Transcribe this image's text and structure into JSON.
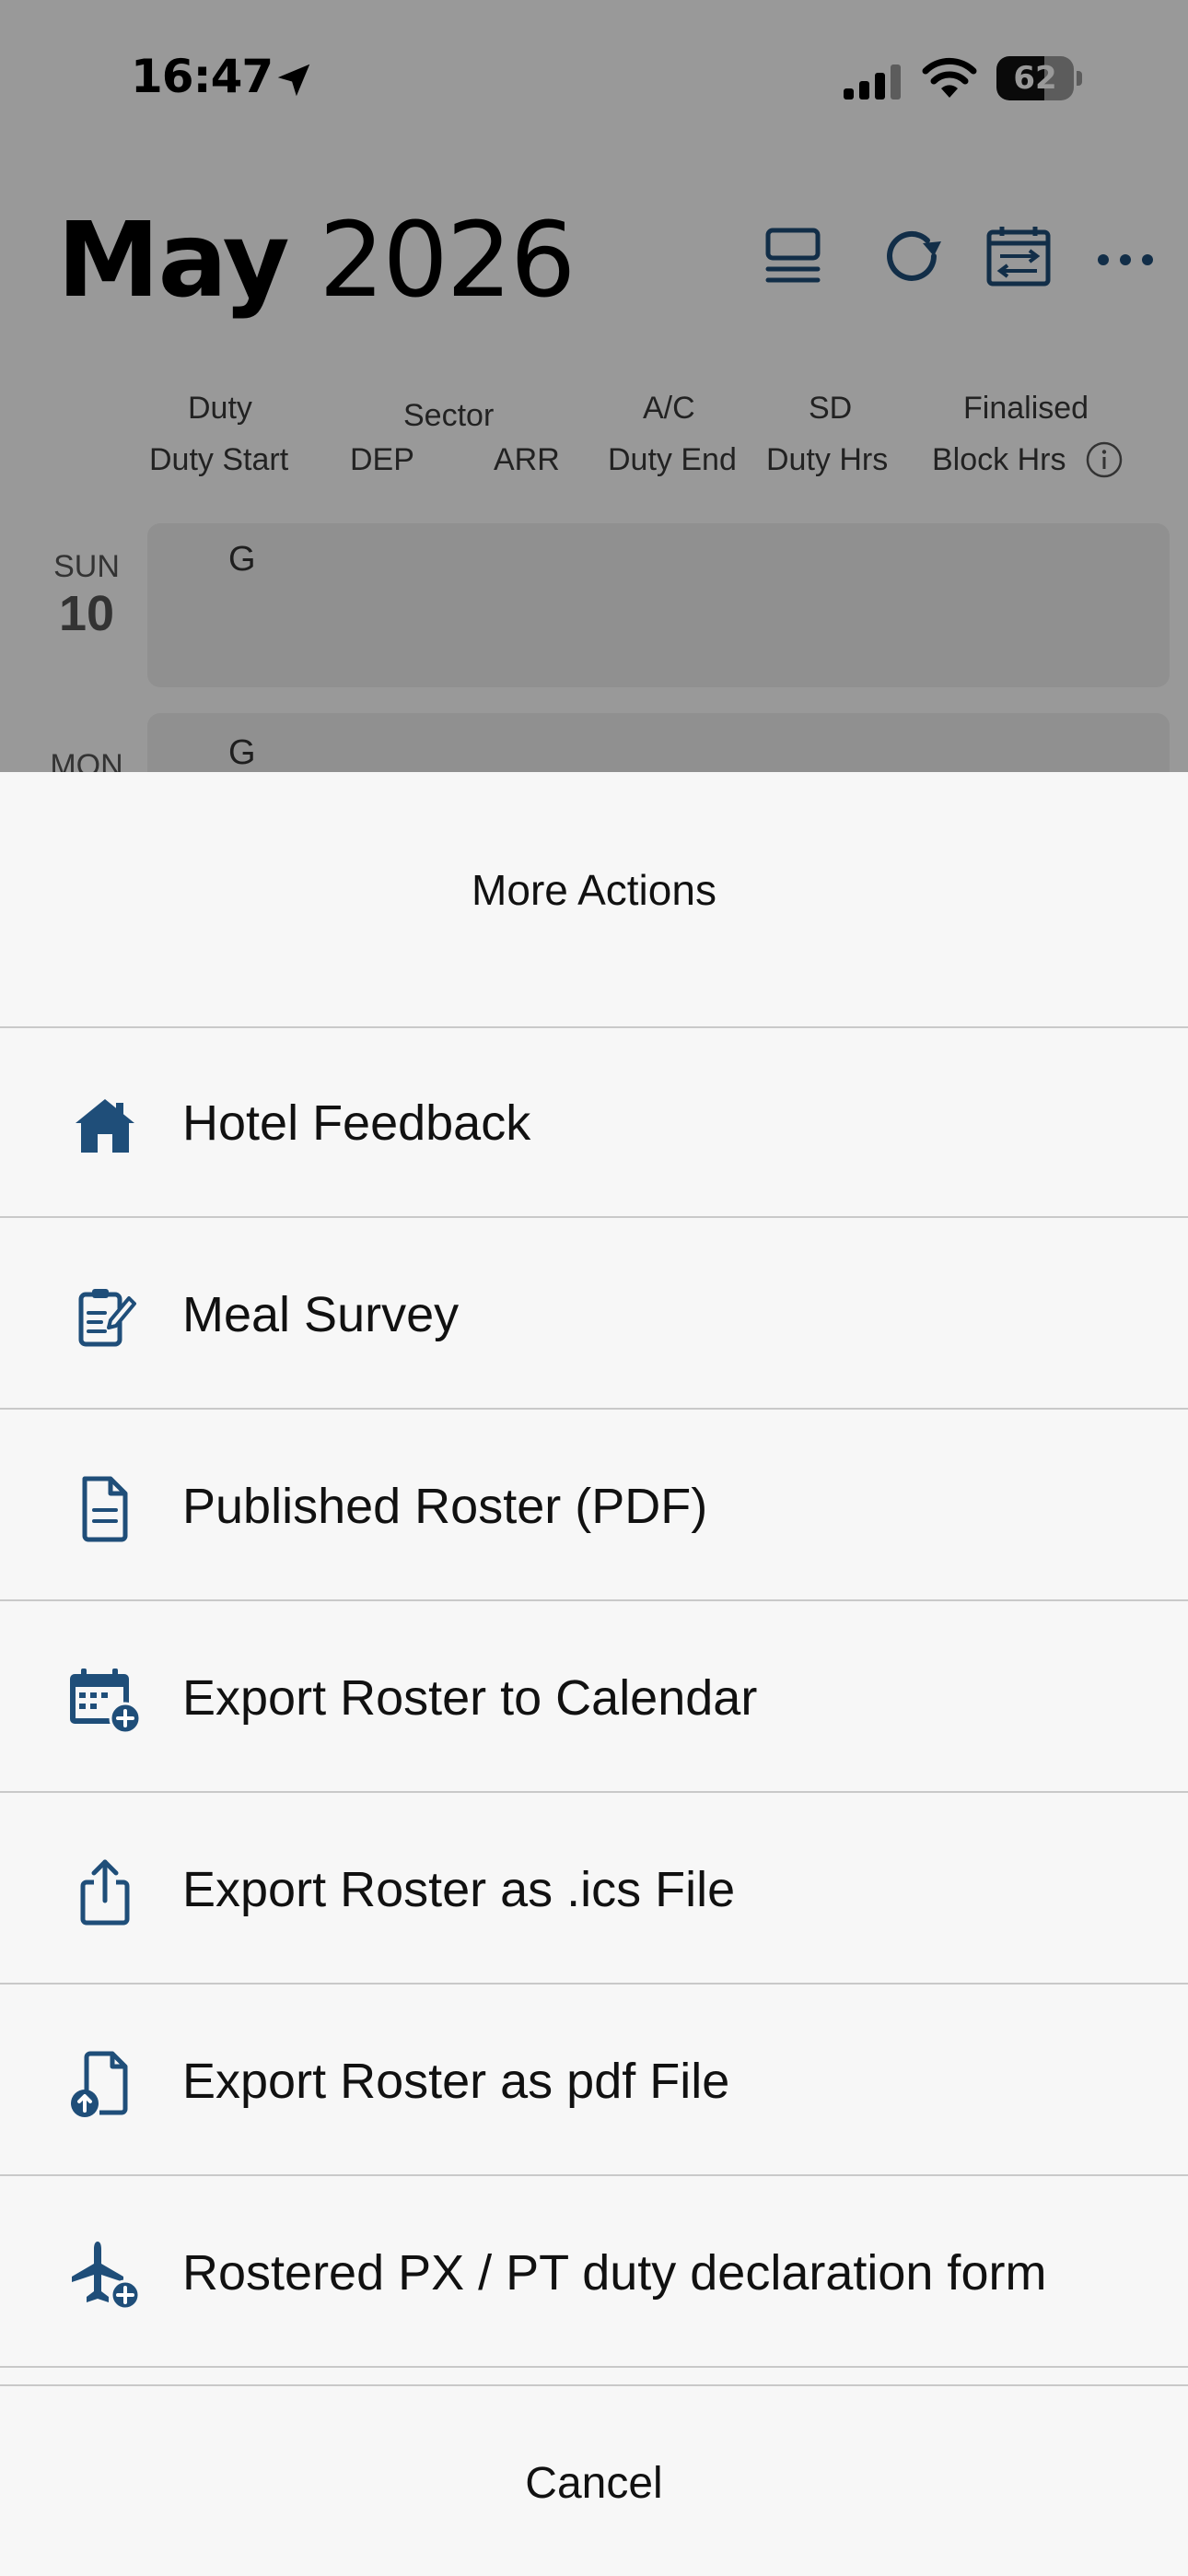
{
  "status_bar": {
    "time": "16:47",
    "battery": "62",
    "battery_level": 0.62
  },
  "header": {
    "month": "May",
    "year": "2026"
  },
  "columns": {
    "duty": "Duty",
    "duty_start": "Duty Start",
    "sector": "Sector",
    "dep": "DEP",
    "arr": "ARR",
    "ac": "A/C",
    "duty_end": "Duty End",
    "sd": "SD",
    "duty_hrs": "Duty Hrs",
    "finalised": "Finalised",
    "block_hrs": "Block Hrs"
  },
  "days": [
    {
      "name": "SUN",
      "number": "10",
      "code": "G"
    },
    {
      "name": "MON",
      "number": "",
      "code": "G"
    }
  ],
  "sheet": {
    "title": "More Actions",
    "actions": [
      {
        "label": "Hotel Feedback",
        "icon": "house-icon"
      },
      {
        "label": "Meal Survey",
        "icon": "clipboard-edit-icon"
      },
      {
        "label": "Published Roster (PDF)",
        "icon": "document-icon"
      },
      {
        "label": "Export Roster to Calendar",
        "icon": "calendar-add-icon"
      },
      {
        "label": "Export Roster as .ics File",
        "icon": "share-icon"
      },
      {
        "label": "Export Roster as pdf File",
        "icon": "file-upload-icon"
      },
      {
        "label": "Rostered PX / PT duty declaration form",
        "icon": "airplane-add-icon"
      }
    ],
    "cancel": "Cancel"
  },
  "colors": {
    "accent": "#1f4e79",
    "sheet_bg": "#f7f7f7",
    "divider": "#c9c9c9"
  }
}
